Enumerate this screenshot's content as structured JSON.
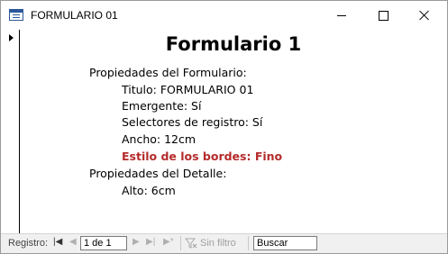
{
  "window": {
    "title": "FORMULARIO 01"
  },
  "form": {
    "heading": "Formulario 1",
    "lines": [
      "Propiedades del Formulario:",
      "Titulo: FORMULARIO 01",
      "Emergente: Sí",
      "Selectores de registro: Sí",
      "Ancho: 12cm",
      "Estilo de los bordes: Fino",
      "Propiedades del Detalle:",
      "Alto: 6cm"
    ]
  },
  "statusbar": {
    "record_label": "Registro:",
    "record_value": "1 de 1",
    "filter_label": "Sin filtro",
    "search_label": "Buscar"
  },
  "colors": {
    "accent": "#2b579a",
    "highlight": "#b52b2b"
  }
}
